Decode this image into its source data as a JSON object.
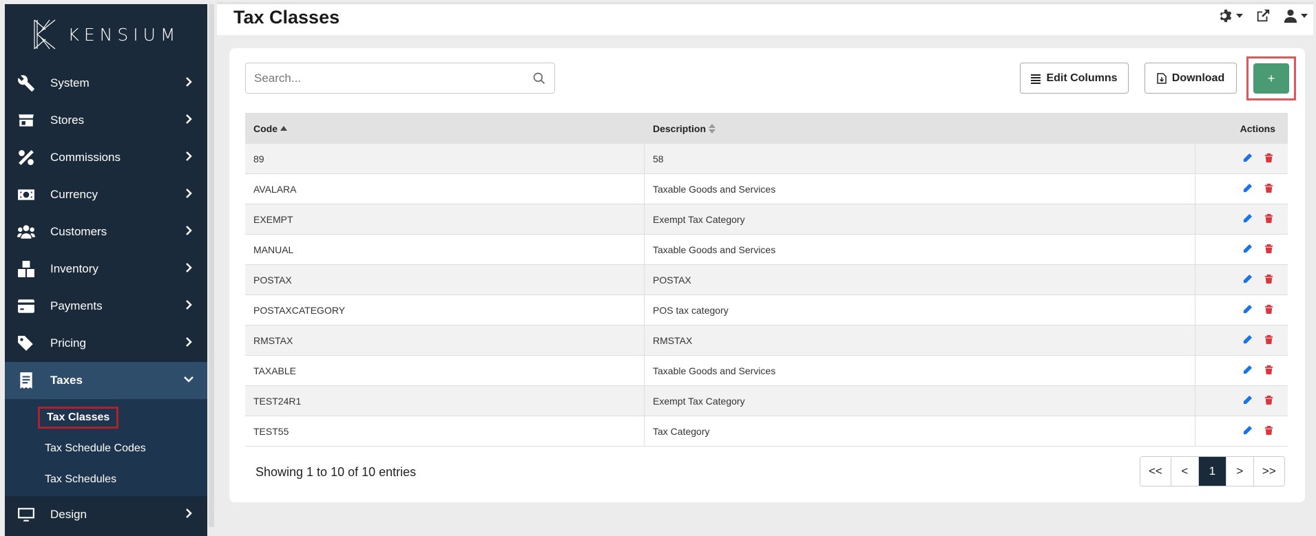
{
  "brand": {
    "name": "KENSIUM"
  },
  "sidebar": {
    "items": [
      {
        "label": "System",
        "icon": "wrench-icon"
      },
      {
        "label": "Stores",
        "icon": "store-icon"
      },
      {
        "label": "Commissions",
        "icon": "percent-icon"
      },
      {
        "label": "Currency",
        "icon": "money-bill-icon"
      },
      {
        "label": "Customers",
        "icon": "users-icon"
      },
      {
        "label": "Inventory",
        "icon": "boxes-icon"
      },
      {
        "label": "Payments",
        "icon": "credit-card-icon"
      },
      {
        "label": "Pricing",
        "icon": "tags-icon"
      },
      {
        "label": "Taxes",
        "icon": "receipt-icon"
      },
      {
        "label": "Design",
        "icon": "desktop-icon"
      }
    ],
    "taxes_sub": [
      {
        "label": "Tax Classes"
      },
      {
        "label": "Tax Schedule Codes"
      },
      {
        "label": "Tax Schedules"
      }
    ]
  },
  "header": {
    "title": "Tax Classes"
  },
  "toolbar": {
    "search_placeholder": "Search...",
    "edit_columns_label": "Edit Columns",
    "download_label": "Download",
    "add_label": "+"
  },
  "table": {
    "headers": {
      "code": "Code",
      "description": "Description",
      "actions": "Actions"
    },
    "rows": [
      {
        "code": "89",
        "description": "58"
      },
      {
        "code": "AVALARA",
        "description": "Taxable Goods and Services"
      },
      {
        "code": "EXEMPT",
        "description": "Exempt Tax Category"
      },
      {
        "code": "MANUAL",
        "description": "Taxable Goods and Services"
      },
      {
        "code": "POSTAX",
        "description": "POSTAX"
      },
      {
        "code": "POSTAXCATEGORY",
        "description": "POS tax category"
      },
      {
        "code": "RMSTAX",
        "description": "RMSTAX"
      },
      {
        "code": "TAXABLE",
        "description": "Taxable Goods and Services"
      },
      {
        "code": "TEST24R1",
        "description": "Exempt Tax Category"
      },
      {
        "code": "TEST55",
        "description": "Tax Category"
      }
    ]
  },
  "footer": {
    "showing": "Showing 1 to 10 of 10 entries",
    "pager": [
      "<<",
      "<",
      "1",
      ">",
      ">>"
    ]
  },
  "colors": {
    "sidebar_bg": "#1b2a3b",
    "add_button": "#4a9a74",
    "edit_icon": "#1a73e8",
    "delete_icon": "#d9363e",
    "highlight": "#b0222a"
  }
}
